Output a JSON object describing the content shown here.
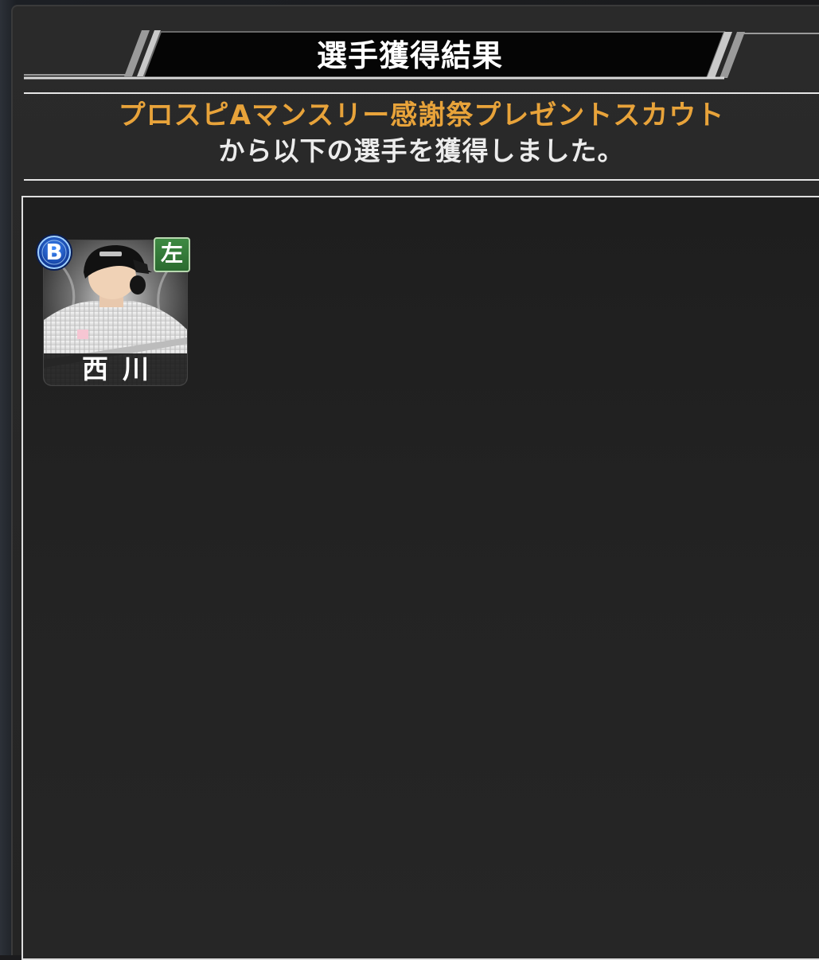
{
  "dialog": {
    "title": "選手獲得結果",
    "scout_name": "プロスピAマンスリー感謝祭プレゼントスカウト",
    "message": "から以下の選手を獲得しました。"
  },
  "players": [
    {
      "name": "西川",
      "rank": "B",
      "hand": "左"
    }
  ],
  "colors": {
    "scout_name": "#e8a33a",
    "rank_badge": "#1f5fd6",
    "hand_badge": "#2f7a34"
  },
  "icons": {
    "rank": "rank-b-badge-icon",
    "hand": "left-hand-badge-icon"
  }
}
